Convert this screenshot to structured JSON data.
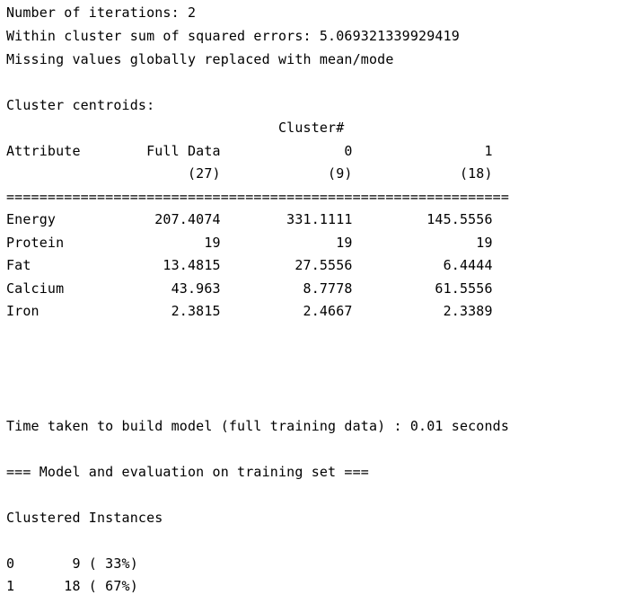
{
  "output_lines": [
    "Number of iterations: 2",
    "Within cluster sum of squared errors: 5.069321339929419",
    "Missing values globally replaced with mean/mode",
    "",
    "Cluster centroids:",
    "                                 Cluster#",
    "Attribute        Full Data               0                1",
    "                      (27)             (9)             (18)",
    "=============================================================",
    "Energy            207.4074        331.1111         145.5556",
    "Protein                 19              19               19",
    "Fat                13.4815         27.5556           6.4444",
    "Calcium             43.963          8.7778          61.5556",
    "Iron                2.3815          2.4667           2.3389",
    "",
    "",
    "",
    "",
    "",
    "Time taken to build model (full training data) : 0.01 seconds",
    "",
    "=== Model and evaluation on training set ===",
    "",
    "Clustered Instances",
    "",
    "0       9 ( 33%)",
    "1      18 ( 67%)"
  ]
}
